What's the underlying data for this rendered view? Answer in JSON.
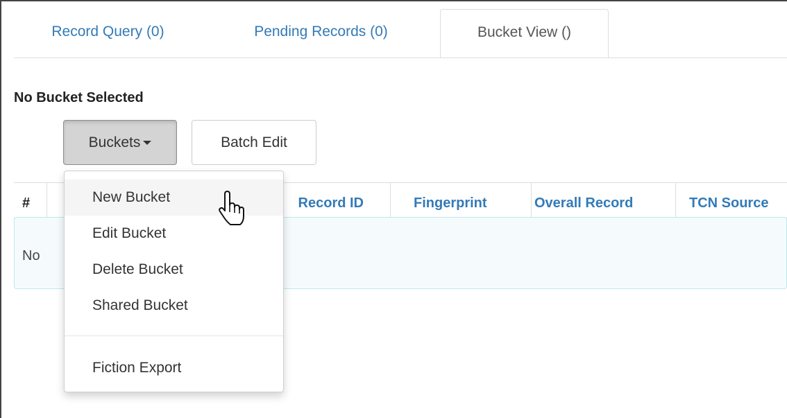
{
  "tabs": [
    {
      "label": "Record Query (0)",
      "active": false
    },
    {
      "label": "Pending Records (0)",
      "active": false
    },
    {
      "label": "Bucket View ()",
      "active": true
    }
  ],
  "bucket_status": "No Bucket Selected",
  "toolbar": {
    "buckets_label": "Buckets",
    "batch_edit_label": "Batch Edit"
  },
  "table": {
    "columns": [
      "#",
      "Record ID",
      "Fingerprint",
      "Overall Record",
      "TCN Source"
    ],
    "empty_text": "No"
  },
  "dropdown": {
    "items": [
      "New Bucket",
      "Edit Bucket",
      "Delete Bucket",
      "Shared Bucket"
    ],
    "extra_items": [
      "Fiction Export"
    ],
    "hovered": "New Bucket"
  },
  "colors": {
    "link": "#337ab7",
    "active_button": "#d4d4d4",
    "info_border": "#bce8f1"
  },
  "icons": [
    "caret-down-icon",
    "hand-pointer-cursor-icon"
  ]
}
